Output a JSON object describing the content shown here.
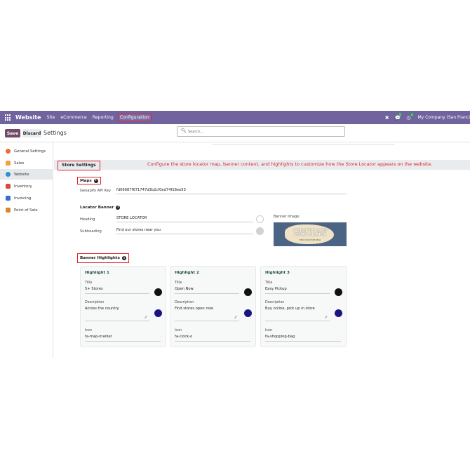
{
  "navbar": {
    "brand": "Website",
    "items": [
      "Site",
      "eCommerce",
      "Reporting"
    ],
    "active_item": "Configuration",
    "badge_chat": "5",
    "badge_activity": "4",
    "company": "My Company (San Franci"
  },
  "controls": {
    "save": "Save",
    "discard": "Discard",
    "title": "Settings",
    "search_placeholder": "Search..."
  },
  "sidebar": {
    "items": [
      {
        "label": "General Settings",
        "color": "#f06b39"
      },
      {
        "label": "Sales",
        "color": "#f0a23b"
      },
      {
        "label": "Website",
        "color": "#2a8fd6"
      },
      {
        "label": "Inventory",
        "color": "#d94a3a"
      },
      {
        "label": "Invoicing",
        "color": "#3470c9"
      },
      {
        "label": "Point of Sale",
        "color": "#e0842b"
      }
    ],
    "active_index": 2
  },
  "section": {
    "title": "Store Settings",
    "description": "Configure the store locator map, banner content, and highlights to customize how the Store Locator appears on the website."
  },
  "maps": {
    "title": "Maps",
    "api_key_label": "Geoapify API Key",
    "api_key_value": "fd06687f671747d3b2cf0ed74f18ee53"
  },
  "locator_banner": {
    "title": "Locator Banner",
    "heading_label": "Heading",
    "heading_value": "STORE LOCATOR",
    "heading_color": "#ffffff",
    "subheading_label": "Subheading",
    "subheading_value": "Find our stores near you",
    "subheading_color": "#cfd2d4",
    "image_label": "Banner Image",
    "image_text_1": "WEBLYTIC LABS",
    "image_text_2": "STORE LOCATOR",
    "image_text_3": "FIND OUR STORE NEAR"
  },
  "highlights": {
    "title": "Banner Highlights",
    "cards": [
      {
        "name": "Highlight 1",
        "title_label": "Title",
        "title": "5+ Stores",
        "title_color": "#111111",
        "desc_label": "Description",
        "description": "Across the country",
        "desc_color": "#1a1580",
        "icon_label": "Icon",
        "icon": "fa-map-marker"
      },
      {
        "name": "Highlight 2",
        "title_label": "Title",
        "title": "Open Now",
        "title_color": "#111111",
        "desc_label": "Description",
        "description": "Find stores open now",
        "desc_color": "#1a1580",
        "icon_label": "Icon",
        "icon": "fa-clock-o"
      },
      {
        "name": "Highlight 3",
        "title_label": "Title",
        "title": "Easy Pickup",
        "title_color": "#111111",
        "desc_label": "Description",
        "description": "Buy online, pick up in store",
        "desc_color": "#1a1580",
        "icon_label": "Icon",
        "icon": "fa-shopping-bag"
      }
    ]
  }
}
